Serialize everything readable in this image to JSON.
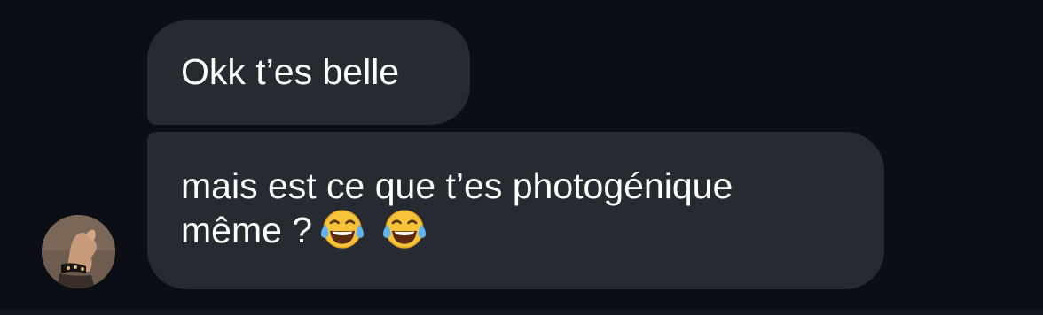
{
  "conversation": {
    "messages": [
      {
        "text": "Okk t’es belle"
      },
      {
        "line1": "mais est ce que t’es photogénique",
        "line2": "même ?",
        "emojis": [
          "face-with-tears-of-joy-icon",
          "face-with-tears-of-joy-icon"
        ]
      }
    ],
    "avatar": {
      "icon": "contact-avatar"
    }
  },
  "colors": {
    "background": "#0b0e14",
    "bubble": "#262a31",
    "text": "#ffffff",
    "emoji_face": "#f7c33a",
    "emoji_tears": "#5fb3f0"
  }
}
